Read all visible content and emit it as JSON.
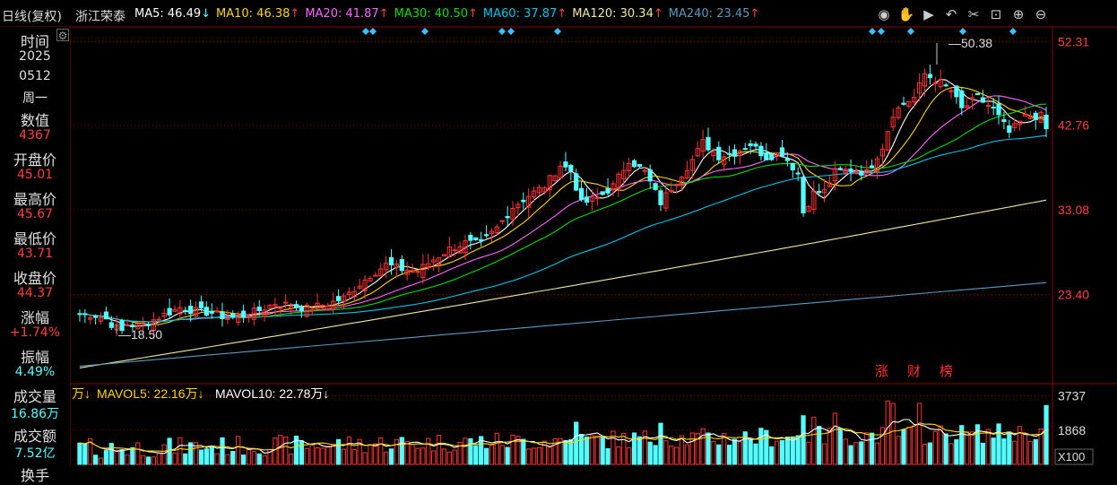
{
  "legend": {
    "title": "日线(复权)",
    "stock_name": "浙江荣泰",
    "ma": [
      {
        "label": "MA5: 46.49",
        "arrow": "↓",
        "color": "#ffffff"
      },
      {
        "label": "MA10: 46.38",
        "arrow": "↑",
        "color": "#ffd700"
      },
      {
        "label": "MA20: 41.87",
        "arrow": "↑",
        "color": "#ff66ff"
      },
      {
        "label": "MA30: 40.50",
        "arrow": "↑",
        "color": "#00e000"
      },
      {
        "label": "MA60: 37.87",
        "arrow": "↑",
        "color": "#00c8e8"
      },
      {
        "label": "MA120: 30.34",
        "arrow": "↑",
        "color": "#f0e6a0"
      },
      {
        "label": "MA240: 23.45",
        "arrow": "↑",
        "color": "#5a9abf"
      }
    ]
  },
  "toolbar": {
    "icons": [
      "eye-icon",
      "hand-icon",
      "play-icon",
      "undo-icon",
      "scissors-icon",
      "lock-icon",
      "zoom-in-icon",
      "zoom-out-icon"
    ]
  },
  "sidebar": {
    "gear_icon": "gear-icon",
    "items": [
      {
        "label": "时间",
        "value": "2025"
      },
      {
        "label": "0512",
        "value": "周一"
      },
      {
        "label": "数值",
        "value": "4367"
      },
      {
        "label": "开盘价",
        "value": "45.01"
      },
      {
        "label": "最高价",
        "value": "45.67"
      },
      {
        "label": "最低价",
        "value": "43.71"
      },
      {
        "label": "收盘价",
        "value": "44.37"
      },
      {
        "label": "涨幅",
        "value": "+1.74%"
      },
      {
        "label": "振幅",
        "value": "4.49%"
      },
      {
        "label": "成交量",
        "value": "16.86万"
      },
      {
        "label": "成交额",
        "value": "7.52亿"
      },
      {
        "label": "换手",
        "value": ""
      }
    ]
  },
  "volume_legend": {
    "unit_prefix": "万↓",
    "mavol5": "MAVOL5: 22.16万",
    "mavol5_arrow": "↓",
    "mavol10": "MAVOL10: 22.78万",
    "mavol10_arrow": "↓"
  },
  "colors": {
    "up": "#ff3232",
    "down": "#54ffff",
    "grid": "#8b0000",
    "axis_text": "#ff4040"
  },
  "chart_data": {
    "type": "candlestick",
    "price_axis": {
      "ticks": [
        "52.31",
        "42.76",
        "33.08",
        "23.40"
      ],
      "ylim": [
        13.5,
        54.0
      ]
    },
    "volume_axis": {
      "ticks": [
        "3737",
        "1868"
      ],
      "ylim": [
        0,
        4300
      ],
      "unit_label": "X100"
    },
    "annotations": {
      "high_label": "50.38",
      "low_label": "18.50",
      "event_labels": [
        "涨",
        "财",
        "榜"
      ]
    },
    "moving_averages": [
      {
        "name": "MA5",
        "color": "#ffffff"
      },
      {
        "name": "MA10",
        "color": "#ffd700"
      },
      {
        "name": "MA20",
        "color": "#ff66ff"
      },
      {
        "name": "MA30",
        "color": "#00e000"
      },
      {
        "name": "MA60",
        "color": "#00c8e8"
      },
      {
        "name": "MA120",
        "color": "#f0e6a0"
      },
      {
        "name": "MA240",
        "color": "#5a9abf"
      }
    ],
    "volume_ma": [
      {
        "name": "MAVOL5",
        "color": "#ffffff"
      },
      {
        "name": "MAVOL10",
        "color": "#ffd700"
      }
    ],
    "close_path": [
      [
        0,
        21.2
      ],
      [
        3,
        21.0
      ],
      [
        5,
        20.6
      ],
      [
        6,
        20.0
      ],
      [
        7,
        19.6
      ],
      [
        8,
        19.2
      ],
      [
        9,
        20.0
      ],
      [
        11,
        19.8
      ],
      [
        13,
        20.2
      ],
      [
        16,
        21.1
      ],
      [
        19,
        21.9
      ],
      [
        22,
        21.5
      ],
      [
        25,
        21.3
      ],
      [
        28,
        20.7
      ],
      [
        31,
        21.0
      ],
      [
        34,
        21.6
      ],
      [
        37,
        22.4
      ],
      [
        40,
        22.2
      ],
      [
        43,
        21.8
      ],
      [
        47,
        22.3
      ],
      [
        50,
        23.0
      ],
      [
        53,
        24.6
      ],
      [
        55,
        25.6
      ],
      [
        58,
        26.8
      ],
      [
        61,
        26.3
      ],
      [
        64,
        26.1
      ],
      [
        67,
        27.4
      ],
      [
        70,
        28.6
      ],
      [
        73,
        29.3
      ],
      [
        76,
        29.2
      ],
      [
        79,
        31.0
      ],
      [
        82,
        33.4
      ],
      [
        85,
        34.7
      ],
      [
        88,
        35.8
      ],
      [
        91,
        38.2
      ],
      [
        93,
        37.6
      ],
      [
        95,
        33.8
      ],
      [
        98,
        34.4
      ],
      [
        101,
        35.8
      ],
      [
        104,
        38.8
      ],
      [
        107,
        37.4
      ],
      [
        110,
        33.9
      ],
      [
        113,
        36.4
      ],
      [
        116,
        38.8
      ],
      [
        118,
        40.8
      ],
      [
        121,
        39.2
      ],
      [
        124,
        39.6
      ],
      [
        127,
        40.6
      ],
      [
        130,
        39.1
      ],
      [
        133,
        39.6
      ],
      [
        136,
        37.2
      ],
      [
        137,
        32.8
      ],
      [
        139,
        35.0
      ],
      [
        141,
        35.2
      ],
      [
        143,
        37.4
      ],
      [
        146,
        37.7
      ],
      [
        149,
        37.3
      ],
      [
        152,
        40.3
      ],
      [
        154,
        44.1
      ],
      [
        156,
        45.2
      ],
      [
        158,
        45.9
      ],
      [
        160,
        48.6
      ],
      [
        163,
        47.6
      ],
      [
        165,
        46.7
      ],
      [
        167,
        44.6
      ],
      [
        170,
        45.9
      ],
      [
        173,
        44.6
      ],
      [
        176,
        41.9
      ],
      [
        179,
        43.7
      ],
      [
        182,
        43.8
      ],
      [
        183,
        42.3
      ]
    ]
  }
}
